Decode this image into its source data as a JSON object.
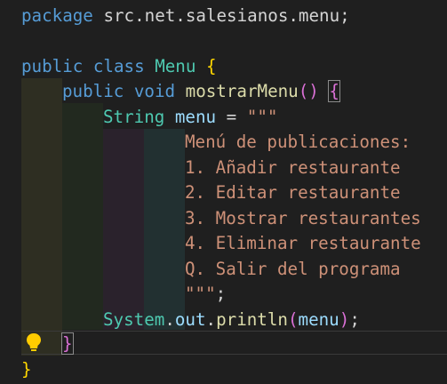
{
  "code": {
    "l1": {
      "package_kw": "package",
      "pkg_name": "src.net.salesianos.menu",
      "semicolon": ";"
    },
    "l3": {
      "public_kw": "public",
      "class_kw": "class",
      "class_name": "Menu",
      "brace": "{"
    },
    "l4": {
      "public_kw": "public",
      "void_kw": "void",
      "method_name": "mostrarMenu",
      "paren_open": "(",
      "paren_close": ")",
      "brace": "{"
    },
    "l5": {
      "type": "String",
      "var": "menu",
      "eq": "=",
      "str_open": "\"\"\""
    },
    "text_block": [
      "Menú de publicaciones:",
      "1. Añadir restaurante",
      "2. Editar restaurante",
      "3. Mostrar restaurantes",
      "4. Eliminar restaurante",
      "Q. Salir del programa"
    ],
    "l12": {
      "str_close": "\"\"\"",
      "semicolon": ";"
    },
    "l13": {
      "system": "System",
      "dot1": ".",
      "out": "out",
      "dot2": ".",
      "println": "println",
      "paren_open": "(",
      "arg": "menu",
      "paren_close": ")",
      "semicolon": ";"
    },
    "l14": {
      "brace": "}"
    },
    "l15": {
      "brace": "}"
    }
  },
  "colors": {
    "background": "#1f1f1f",
    "keyword": "#569cd6",
    "type": "#4ec9b0",
    "function": "#dcdcaa",
    "variable": "#9cdcfe",
    "string": "#ce9178",
    "bracket_level1": "#ffd700",
    "bracket_level2": "#da70d6",
    "lightbulb": "#ffcc00"
  },
  "icons": {
    "lightbulb": "lightbulb-icon"
  }
}
